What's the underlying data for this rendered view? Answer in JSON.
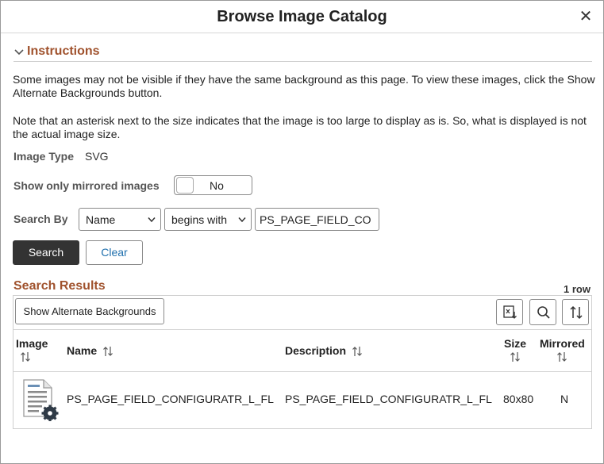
{
  "dialog": {
    "title": "Browse Image Catalog",
    "close_icon": "close-icon"
  },
  "instructions": {
    "header": "Instructions",
    "para1": "Some images may not be visible if they have the same background as this page. To view these images, click the Show Alternate Backgrounds button.",
    "para2": "Note that an asterisk next to the size indicates that the image is too large to display as is. So, what is displayed is not the actual image size."
  },
  "image_type": {
    "label": "Image Type",
    "value": "SVG"
  },
  "mirrored_filter": {
    "label": "Show only mirrored images",
    "toggle_text": "No"
  },
  "search": {
    "label": "Search By",
    "field_select": "Name",
    "operator_select": "begins with",
    "query_value": "PS_PAGE_FIELD_CO",
    "search_button": "Search",
    "clear_button": "Clear"
  },
  "results": {
    "header": "Search Results",
    "row_count": "1 row",
    "alt_backgrounds_button": "Show Alternate Backgrounds",
    "toolbar_icons": [
      "export-icon",
      "search-icon",
      "sort-icon"
    ],
    "columns": {
      "image": "Image",
      "name": "Name",
      "description": "Description",
      "size": "Size",
      "mirrored": "Mirrored"
    },
    "rows": [
      {
        "image_icon": "page-settings-icon",
        "name": "PS_PAGE_FIELD_CONFIGURATR_L_FL",
        "description": "PS_PAGE_FIELD_CONFIGURATR_L_FL",
        "size": "80x80",
        "mirrored": "N"
      }
    ]
  },
  "colors": {
    "section_header": "#a0522d",
    "dark_button": "#333333",
    "link": "#1f6fad"
  }
}
